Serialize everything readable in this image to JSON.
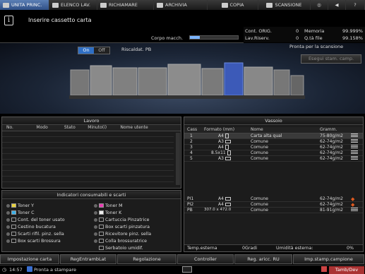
{
  "tabs": [
    {
      "label": "UNITA PRINC.",
      "icon": "home-icon",
      "active": true
    },
    {
      "label": "ELENCO LAV.",
      "icon": "job-list-icon"
    },
    {
      "label": "RICHIAMARE",
      "icon": "recall-icon"
    },
    {
      "label": "ARCHIVIA",
      "icon": "archive-icon"
    },
    {
      "label": "COPIA",
      "icon": "copy-icon"
    },
    {
      "label": "SCANSIONE",
      "icon": "scan-icon"
    }
  ],
  "message": "Inserire cassetto carta",
  "corpo_label": "Corpo macch.",
  "corpo_level": 0.2,
  "counters": {
    "cont_orig_label": "Cont. ORIG.",
    "cont_orig_value": "0",
    "memoria_label": "Memoria",
    "memoria_value": "99.999%",
    "lav_riserv_label": "Lav.Riserv.",
    "lav_riserv_value": "0",
    "qta_file_label": "Q.tà file",
    "qta_file_value": "99.158%"
  },
  "heater": {
    "on_label": "On",
    "off_label": "Off",
    "label": "Riscaldat. PB"
  },
  "scan_ready": "Pronta per la scansione",
  "esegui_label": "Esegui stam. camp.",
  "lavoro": {
    "title": "Lavoro",
    "headers": [
      "No.",
      "Modo",
      "Stato",
      "Minuto(i)",
      "Nome utente"
    ]
  },
  "vassoio": {
    "title": "Vassoio",
    "headers": [
      "Cass",
      "Formato (mm)",
      "Nome",
      "Gramm."
    ],
    "rows": [
      {
        "cass": "1",
        "formato": "A4",
        "nome": "Carta alta qual",
        "gramm": "75-80g/m2",
        "selected": true
      },
      {
        "cass": "2",
        "formato": "A3",
        "nome": "Comune",
        "gramm": "62-74g/m2"
      },
      {
        "cass": "3",
        "formato": "A4",
        "nome": "Comune",
        "gramm": "62-74g/m2"
      },
      {
        "cass": "4",
        "formato": "8.5x11",
        "nome": "Comune",
        "gramm": "62-74g/m2"
      },
      {
        "cass": "5",
        "formato": "A3",
        "nome": "Comune",
        "gramm": "62-74g/m2"
      }
    ],
    "rows2": [
      {
        "cass": "PI1",
        "formato": "A4",
        "nome": "Comune",
        "gramm": "62-74g/m2"
      },
      {
        "cass": "PI2",
        "formato": "A4",
        "nome": "Comune",
        "gramm": "62-74g/m2"
      },
      {
        "cass": "PB",
        "formato": "307.0 x 472.0",
        "nome": "Comune",
        "gramm": "81-91g/m2"
      }
    ],
    "temp_label": "Temp.esterna",
    "temp_value": "0Gradi",
    "umid_label": "Umidità esterna:",
    "umid_value": "0%"
  },
  "consumabili": {
    "title": "Indicatori consumabili e scarti",
    "left": [
      {
        "label": "Toner Y",
        "color": "#e8d23a"
      },
      {
        "label": "Toner C",
        "color": "#3ab0e8"
      },
      {
        "label": "Cont. del toner usato",
        "color": "#ccc"
      },
      {
        "label": "Cestino bucatura",
        "color": "#ccc"
      },
      {
        "label": "Scarti rifil. pinz. sella",
        "color": "#ccc"
      },
      {
        "label": "Box scarti Brossura",
        "color": "#ccc"
      }
    ],
    "right": [
      {
        "label": "Toner M",
        "color": "#e83ab0"
      },
      {
        "label": "Toner K",
        "color": "#eeeeee"
      },
      {
        "label": "Cartuccia Pinzatrice",
        "color": "#ccc"
      },
      {
        "label": "Box scarti pinzatura",
        "color": "#ccc"
      },
      {
        "label": "Ricevitore pinz. sella",
        "color": "#ccc"
      },
      {
        "label": "Colla brossuratrice",
        "color": "#ccc"
      },
      {
        "label": "Serbatoio umidif.",
        "color": "#ccc"
      }
    ]
  },
  "buttons": [
    "Impostazione carta",
    "RegEntrambLat",
    "Regolazione",
    "Controller",
    "Reg. aricc. RU",
    "Imp.stamp.campione"
  ],
  "status": {
    "time": "14:57",
    "text": "Pronta a stampare",
    "right": "Tamb/Dev"
  }
}
